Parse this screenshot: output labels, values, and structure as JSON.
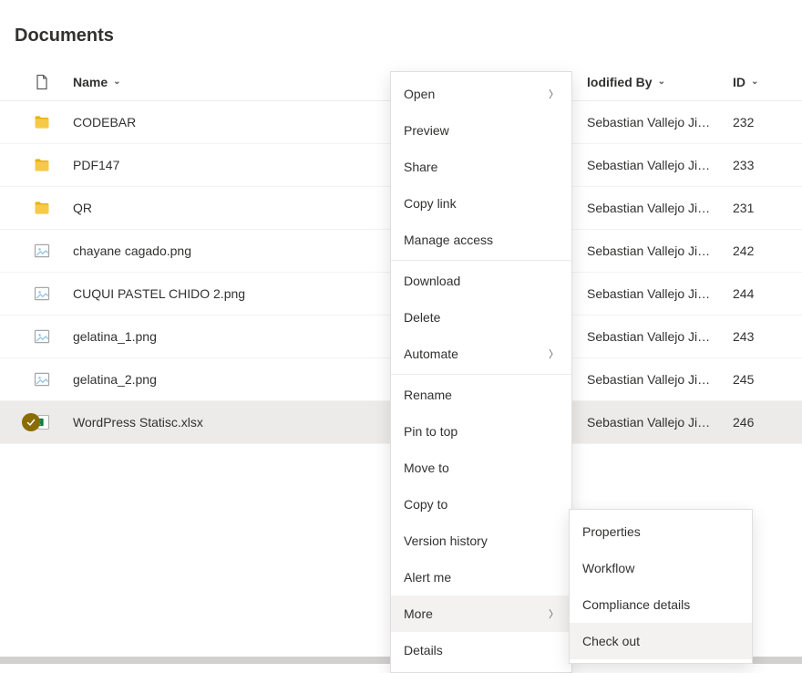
{
  "page": {
    "title": "Documents"
  },
  "columns": {
    "name": "Name",
    "modifiedBy": "Modified By",
    "id": "ID"
  },
  "rows": [
    {
      "type": "folder",
      "name": "CODEBAR",
      "modifiedBy": "Sebastian Vallejo Jime...",
      "id": "232"
    },
    {
      "type": "folder",
      "name": "PDF147",
      "modifiedBy": "Sebastian Vallejo Jime...",
      "id": "233"
    },
    {
      "type": "folder",
      "name": "QR",
      "modifiedBy": "Sebastian Vallejo Jime...",
      "id": "231"
    },
    {
      "type": "image",
      "name": "chayane cagado.png",
      "modifiedBy": "Sebastian Vallejo Jime...",
      "id": "242"
    },
    {
      "type": "image",
      "name": "CUQUI PASTEL CHIDO 2.png",
      "modifiedBy": "Sebastian Vallejo Jime...",
      "id": "244"
    },
    {
      "type": "image",
      "name": "gelatina_1.png",
      "modifiedBy": "Sebastian Vallejo Jime...",
      "id": "243"
    },
    {
      "type": "image",
      "name": "gelatina_2.png",
      "modifiedBy": "Sebastian Vallejo Jime...",
      "id": "245"
    },
    {
      "type": "excel",
      "name": "WordPress Statisc.xlsx",
      "modifiedBy": "Sebastian Vallejo Jime...",
      "id": "246",
      "selected": true
    }
  ],
  "menu": {
    "open": "Open",
    "preview": "Preview",
    "share": "Share",
    "copyLink": "Copy link",
    "manageAccess": "Manage access",
    "download": "Download",
    "delete": "Delete",
    "automate": "Automate",
    "rename": "Rename",
    "pinToTop": "Pin to top",
    "moveTo": "Move to",
    "copyTo": "Copy to",
    "versionHistory": "Version history",
    "alertMe": "Alert me",
    "more": "More",
    "details": "Details"
  },
  "submenu": {
    "properties": "Properties",
    "workflow": "Workflow",
    "complianceDetails": "Compliance details",
    "checkOut": "Check out"
  },
  "modifiedByHeaderDisplayed": "lodified By"
}
